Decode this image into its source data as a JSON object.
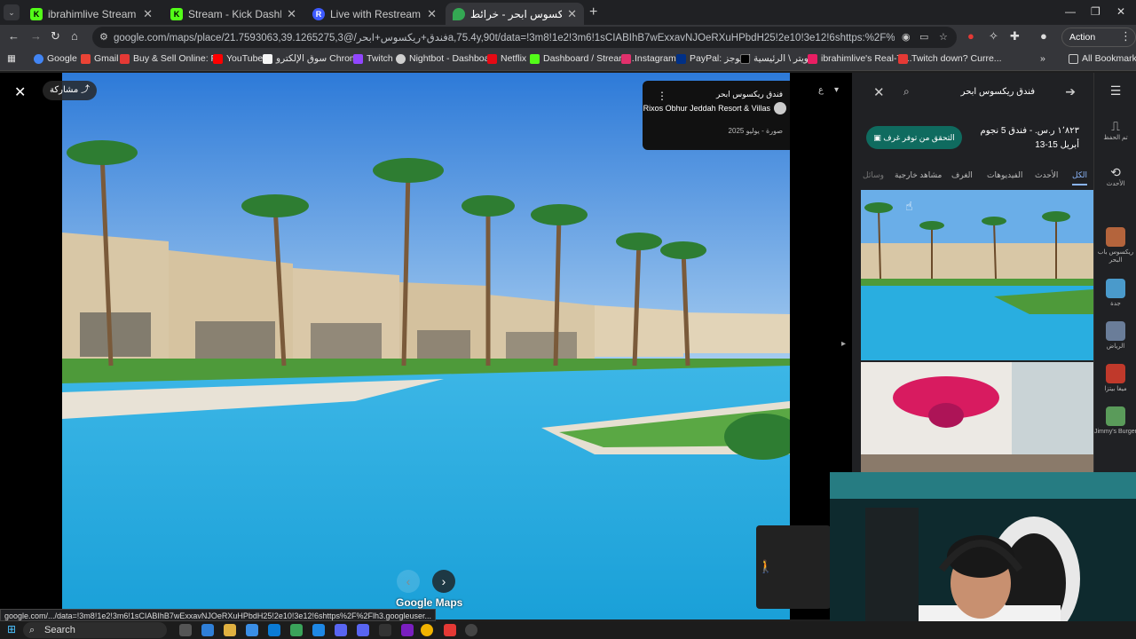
{
  "browser": {
    "tabs": [
      {
        "title": "ibrahimlive Stream - Watch Live",
        "favicon_color": "#53fc18",
        "favicon_text": "K",
        "active": false
      },
      {
        "title": "Stream - Kick Dashboard",
        "favicon_color": "#53fc18",
        "favicon_text": "K",
        "active": false
      },
      {
        "title": "Live with Restream - Restream",
        "favicon_color": "#3d5afe",
        "favicon_text": "R",
        "active": false
      },
      {
        "title": "فندق ريكسوس ابحر - خرائط Google",
        "favicon_color": "#34a853",
        "favicon_text": "",
        "active": true
      }
    ],
    "new_tab_label": "+",
    "url": "google.com/maps/place/فندق+ريكسوس+ابحر/@21.7593063,39.1265275,3a,75.4y,90t/data=!3m8!1e2!3m6!1sCIABIhB7wExxavNJOeRXuHPbdH25!2e10!3e12!6shttps:%2F%2Flh3.googleusercontent.co...",
    "action_required": "Action required",
    "bookmarks": [
      {
        "label": "Google",
        "color": "#4285f4"
      },
      {
        "label": "Gmail",
        "color": "#ea4335"
      },
      {
        "label": "Buy & Sell Online: P...",
        "color": "#e53935"
      },
      {
        "label": "YouTube",
        "color": "#ff0000"
      },
      {
        "label": "سوق الإلكترو Chrome",
        "color": "#f5f5f5"
      },
      {
        "label": "Twitch",
        "color": "#9146ff"
      },
      {
        "label": "Nightbot - Dashboa...",
        "color": "#cfcfcf"
      },
      {
        "label": "Netflix",
        "color": "#e50914"
      },
      {
        "label": "Dashboard / Stream...",
        "color": "#53fc18"
      },
      {
        "label": "Instagram",
        "color": "#e1306c"
      },
      {
        "label": "PayPal: الموجز",
        "color": "#003087"
      },
      {
        "label": "تويتر \\ الرئيسية",
        "color": "#000000"
      },
      {
        "label": "ibrahimlive's Real-Ti...",
        "color": "#e91e63"
      },
      {
        "label": "Twitch down? Curre...",
        "color": "#e53935"
      }
    ],
    "all_bookmarks": "All Bookmarks",
    "status_url": "google.com/.../data=!3m8!1e2!3m6!1sCIABIhB7wExxavNJOeRXuHPbdH25!2e10!3e12!6shttps%2F%2Flh3.googleuser..."
  },
  "viewer": {
    "share_label": "مشاركة",
    "place_name_ar": "فندق ريكسوس ابحر",
    "place_name_en": "Rixos Obhur Jeddah Resort & Villas",
    "photo_date": "صورة - يوليو 2025",
    "maps_logo": "Google Maps",
    "next_label": "›",
    "prev_label": "‹"
  },
  "panel": {
    "search_query": "فندق ريكسوس ابحر",
    "check_button": "التحقق من توفر غرف",
    "price_line": "١٬٨٢٣ ر.س. - فندق 5 نجوم",
    "dates": "13-15 أبريل",
    "tabs": [
      "الكل",
      "الأحدث",
      "الفيديوهات",
      "الغرف",
      "مشاهد خارجية",
      "وسائل"
    ]
  },
  "rail": {
    "items": [
      {
        "label": "تم الحفظ",
        "icon": "bookmark-icon"
      },
      {
        "label": "الأحدث",
        "icon": "history-icon"
      },
      {
        "label": "ريكسوس باب البحر",
        "color": "#b4643c"
      },
      {
        "label": "جدة",
        "color": "#4a9acb"
      },
      {
        "label": "الرياض",
        "color": "#6a7d99"
      },
      {
        "label": "ميغا بيتزا",
        "color": "#c0392b"
      },
      {
        "label": "Jimmy's Burger",
        "color": "#5a9b5a"
      }
    ]
  },
  "taskbar": {
    "search_label": "Search"
  }
}
